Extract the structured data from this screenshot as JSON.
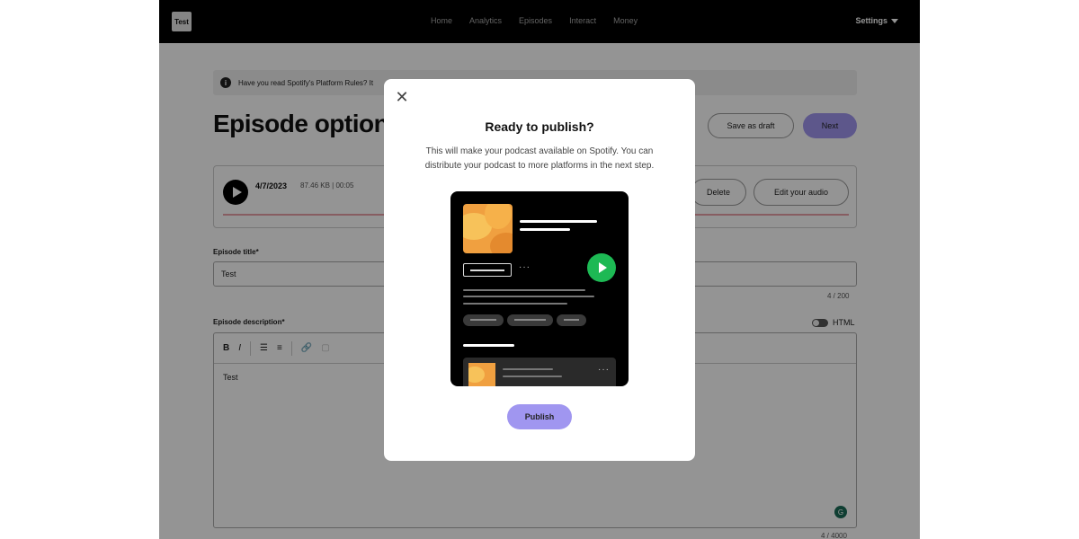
{
  "topbar": {
    "logo_text": "Test",
    "nav": [
      "Home",
      "Analytics",
      "Episodes",
      "Interact",
      "Money"
    ],
    "settings_label": "Settings"
  },
  "notice": {
    "text": "Have you read Spotify's Platform Rules? It"
  },
  "page": {
    "title": "Episode options",
    "save_draft_label": "Save as draft",
    "next_label": "Next"
  },
  "audio": {
    "date": "4/7/2023",
    "meta": "87.46 KB | 00:05",
    "delete_label": "Delete",
    "edit_label": "Edit your audio"
  },
  "episode_title": {
    "label": "Episode title*",
    "value": "Test",
    "counter": "4  /  200"
  },
  "episode_description": {
    "label": "Episode description*",
    "html_label": "HTML",
    "toolbar": [
      "B",
      "I",
      "☰",
      "≡",
      "🔗",
      "▢"
    ],
    "value": "Test",
    "counter": "4  /  4000"
  },
  "modal": {
    "title": "Ready to publish?",
    "text": "This will make your podcast available on Spotify. You can distribute your podcast to more platforms in the next step.",
    "publish_label": "Publish",
    "brand_color": "#1db954",
    "accent_color": "#a096f0"
  }
}
